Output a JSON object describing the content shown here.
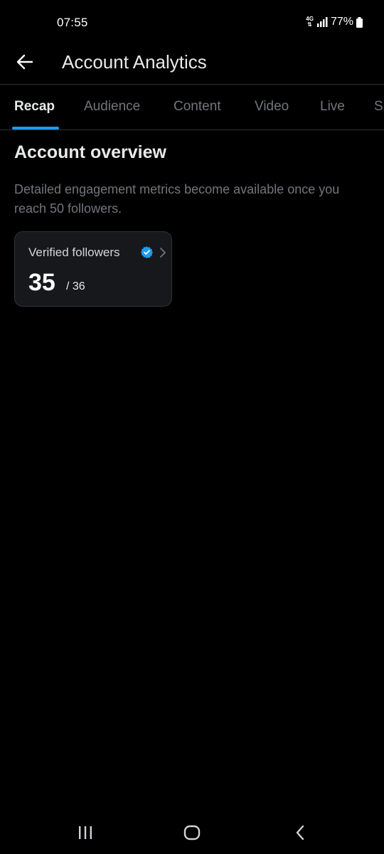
{
  "status_bar": {
    "time": "07:55",
    "network_type": "4G",
    "battery_percent": "77%"
  },
  "header": {
    "title": "Account Analytics",
    "back_icon": "arrow-left-icon"
  },
  "tabs": [
    {
      "label": "Recap",
      "active": true
    },
    {
      "label": "Audience",
      "active": false
    },
    {
      "label": "Content",
      "active": false
    },
    {
      "label": "Video",
      "active": false
    },
    {
      "label": "Live",
      "active": false
    },
    {
      "label": "S",
      "active": false
    }
  ],
  "overview": {
    "title": "Account overview",
    "description": "Detailed engagement metrics become available once you reach 50 followers."
  },
  "metric_card": {
    "label": "Verified followers",
    "value": "35",
    "total": "/ 36",
    "icon": "verified-badge-icon"
  },
  "colors": {
    "accent": "#1d9bf0",
    "background": "#000000",
    "card_background": "#16181c",
    "text_primary": "#e7e9ea",
    "text_secondary": "#71767b"
  },
  "nav_bar": {
    "icons": [
      "recent-apps-icon",
      "home-icon",
      "back-icon"
    ]
  }
}
